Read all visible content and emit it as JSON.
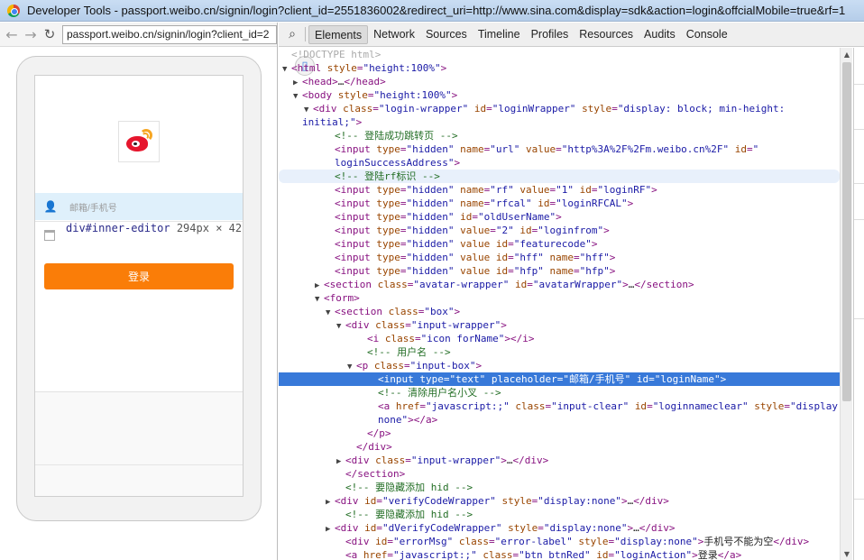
{
  "window": {
    "title": "Developer Tools - passport.weibo.cn/signin/login?client_id=2551836002&redirect_uri=http://www.sina.com&display=sdk&action=login&offcialMobile=true&rf=1"
  },
  "browser": {
    "url": "passport.weibo.cn/signin/login?client_id=2"
  },
  "page": {
    "username_placeholder": "邮箱/手机号",
    "tooltip_selector": "div#inner-editor",
    "tooltip_size_w": "294",
    "tooltip_size_h": "42",
    "tooltip_unit": "px",
    "tooltip_x": "×",
    "login_button": "登录"
  },
  "devtools": {
    "tabs": [
      "Elements",
      "Network",
      "Sources",
      "Timeline",
      "Profiles",
      "Resources",
      "Audits",
      "Console"
    ],
    "active_tab": "Elements"
  },
  "dom_lines": [
    {
      "indent": 0,
      "tri": "",
      "html": "<span class='doctype'>&lt;!DOCTYPE html&gt;</span>"
    },
    {
      "indent": 0,
      "tri": "▼",
      "html": "<span class='tag'>&lt;html</span> <span class='an'>style</span>=<span class='av'>\"height:100%\"</span><span class='tag'>&gt;</span>"
    },
    {
      "indent": 1,
      "tri": "▶",
      "html": "<span class='tag'>&lt;head&gt;</span><span class='txt'>…</span><span class='tag'>&lt;/head&gt;</span>"
    },
    {
      "indent": 1,
      "tri": "▼",
      "html": "<span class='tag'>&lt;body</span> <span class='an'>style</span>=<span class='av'>\"height:100%\"</span><span class='tag'>&gt;</span>"
    },
    {
      "indent": 2,
      "tri": "▼",
      "html": "<span class='tag'>&lt;div</span> <span class='an'>class</span>=<span class='av'>\"login-wrapper\"</span> <span class='an'>id</span>=<span class='av'>\"loginWrapper\"</span> <span class='an'>style</span>=<span class='av'>\"display: block; min-height:</span>"
    },
    {
      "indent": 1,
      "tri": "",
      "html": "<span class='av'>initial;\"</span><span class='tag'>&gt;</span>"
    },
    {
      "indent": 4,
      "tri": "",
      "html": "<span class='cm'>&lt;!-- 登陆成功跳转页 --&gt;</span>"
    },
    {
      "indent": 4,
      "tri": "",
      "html": "<span class='tag'>&lt;input</span> <span class='an'>type</span>=<span class='av'>\"hidden\"</span> <span class='an'>name</span>=<span class='av'>\"url\"</span> <span class='an'>value</span>=<span class='av'>\"http%3A%2F%2Fm.weibo.cn%2F\"</span> <span class='an'>id</span>=<span class='av'>\"</span>"
    },
    {
      "indent": 4,
      "tri": "",
      "html": "<span class='av'>loginSuccessAddress\"</span><span class='tag'>&gt;</span>"
    },
    {
      "indent": 4,
      "tri": "",
      "hover": true,
      "html": "<span class='cm'>&lt;!-- 登陆rf标识 --&gt;</span>"
    },
    {
      "indent": 4,
      "tri": "",
      "html": "<span class='tag'>&lt;input</span> <span class='an'>type</span>=<span class='av'>\"hidden\"</span> <span class='an'>name</span>=<span class='av'>\"rf\"</span> <span class='an'>value</span>=<span class='av'>\"1\"</span> <span class='an'>id</span>=<span class='av'>\"loginRF\"</span><span class='tag'>&gt;</span>"
    },
    {
      "indent": 4,
      "tri": "",
      "html": "<span class='tag'>&lt;input</span> <span class='an'>type</span>=<span class='av'>\"hidden\"</span> <span class='an'>name</span>=<span class='av'>\"rfcal\"</span> <span class='an'>id</span>=<span class='av'>\"loginRFCAL\"</span><span class='tag'>&gt;</span>"
    },
    {
      "indent": 4,
      "tri": "",
      "html": "<span class='tag'>&lt;input</span> <span class='an'>type</span>=<span class='av'>\"hidden\"</span> <span class='an'>id</span>=<span class='av'>\"oldUserName\"</span><span class='tag'>&gt;</span>"
    },
    {
      "indent": 4,
      "tri": "",
      "html": "<span class='tag'>&lt;input</span> <span class='an'>type</span>=<span class='av'>\"hidden\"</span> <span class='an'>value</span>=<span class='av'>\"2\"</span> <span class='an'>id</span>=<span class='av'>\"loginfrom\"</span><span class='tag'>&gt;</span>"
    },
    {
      "indent": 4,
      "tri": "",
      "html": "<span class='tag'>&lt;input</span> <span class='an'>type</span>=<span class='av'>\"hidden\"</span> <span class='an'>value</span> <span class='an'>id</span>=<span class='av'>\"featurecode\"</span><span class='tag'>&gt;</span>"
    },
    {
      "indent": 4,
      "tri": "",
      "html": "<span class='tag'>&lt;input</span> <span class='an'>type</span>=<span class='av'>\"hidden\"</span> <span class='an'>value</span> <span class='an'>id</span>=<span class='av'>\"hff\"</span> <span class='an'>name</span>=<span class='av'>\"hff\"</span><span class='tag'>&gt;</span>"
    },
    {
      "indent": 4,
      "tri": "",
      "html": "<span class='tag'>&lt;input</span> <span class='an'>type</span>=<span class='av'>\"hidden\"</span> <span class='an'>value</span> <span class='an'>id</span>=<span class='av'>\"hfp\"</span> <span class='an'>name</span>=<span class='av'>\"hfp\"</span><span class='tag'>&gt;</span>"
    },
    {
      "indent": 3,
      "tri": "▶",
      "html": "<span class='tag'>&lt;section</span> <span class='an'>class</span>=<span class='av'>\"avatar-wrapper\"</span> <span class='an'>id</span>=<span class='av'>\"avatarWrapper\"</span><span class='tag'>&gt;</span><span class='txt'>…</span><span class='tag'>&lt;/section&gt;</span>"
    },
    {
      "indent": 3,
      "tri": "▼",
      "html": "<span class='tag'>&lt;form&gt;</span>"
    },
    {
      "indent": 4,
      "tri": "▼",
      "html": "<span class='tag'>&lt;section</span> <span class='an'>class</span>=<span class='av'>\"box\"</span><span class='tag'>&gt;</span>"
    },
    {
      "indent": 5,
      "tri": "▼",
      "html": "<span class='tag'>&lt;div</span> <span class='an'>class</span>=<span class='av'>\"input-wrapper\"</span><span class='tag'>&gt;</span>"
    },
    {
      "indent": 7,
      "tri": "",
      "html": "<span class='tag'>&lt;i</span> <span class='an'>class</span>=<span class='av'>\"icon forName\"</span><span class='tag'>&gt;&lt;/i&gt;</span>"
    },
    {
      "indent": 7,
      "tri": "",
      "html": "<span class='cm'>&lt;!-- 用户名 --&gt;</span>"
    },
    {
      "indent": 6,
      "tri": "▼",
      "html": "<span class='tag'>&lt;p</span> <span class='an'>class</span>=<span class='av'>\"input-box\"</span><span class='tag'>&gt;</span>"
    },
    {
      "indent": 8,
      "tri": "",
      "selected": true,
      "html": "<span class='tag'>&lt;input</span> <span class='an'>type</span>=<span class='av'>\"text\"</span> <span class='an'>placeholder</span>=<span class='av'>\"邮箱/手机号\"</span> <span class='an'>id</span>=<span class='av'>\"loginName\"</span><span class='tag'>&gt;</span>"
    },
    {
      "indent": 8,
      "tri": "",
      "html": "<span class='cm'>&lt;!-- 清除用户名小叉 --&gt;</span>"
    },
    {
      "indent": 8,
      "tri": "",
      "html": "<span class='tag'>&lt;a</span> <span class='an'>href</span>=<span class='av'>\"javascript:;\"</span> <span class='an'>class</span>=<span class='av'>\"input-clear\"</span> <span class='an'>id</span>=<span class='av'>\"loginnameclear\"</span> <span class='an'>style</span>=<span class='av'>\"display:</span>"
    },
    {
      "indent": 8,
      "tri": "",
      "html": "<span class='av'>none\"</span><span class='tag'>&gt;&lt;/a&gt;</span>"
    },
    {
      "indent": 7,
      "tri": "",
      "html": "<span class='tag'>&lt;/p&gt;</span>"
    },
    {
      "indent": 6,
      "tri": "",
      "html": "<span class='tag'>&lt;/div&gt;</span>"
    },
    {
      "indent": 5,
      "tri": "▶",
      "html": "<span class='tag'>&lt;div</span> <span class='an'>class</span>=<span class='av'>\"input-wrapper\"</span><span class='tag'>&gt;</span><span class='txt'>…</span><span class='tag'>&lt;/div&gt;</span>"
    },
    {
      "indent": 5,
      "tri": "",
      "html": "<span class='tag'>&lt;/section&gt;</span>"
    },
    {
      "indent": 5,
      "tri": "",
      "html": "<span class='cm'>&lt;!-- 要隐藏添加 hid --&gt;</span>"
    },
    {
      "indent": 4,
      "tri": "▶",
      "html": "<span class='tag'>&lt;div</span> <span class='an'>id</span>=<span class='av'>\"verifyCodeWrapper\"</span> <span class='an'>style</span>=<span class='av'>\"display:none\"</span><span class='tag'>&gt;</span><span class='txt'>…</span><span class='tag'>&lt;/div&gt;</span>"
    },
    {
      "indent": 5,
      "tri": "",
      "html": "<span class='cm'>&lt;!-- 要隐藏添加 hid --&gt;</span>"
    },
    {
      "indent": 4,
      "tri": "▶",
      "html": "<span class='tag'>&lt;div</span> <span class='an'>id</span>=<span class='av'>\"dVerifyCodeWrapper\"</span> <span class='an'>style</span>=<span class='av'>\"display:none\"</span><span class='tag'>&gt;</span><span class='txt'>…</span><span class='tag'>&lt;/div&gt;</span>"
    },
    {
      "indent": 5,
      "tri": "",
      "html": "<span class='tag'>&lt;div</span> <span class='an'>id</span>=<span class='av'>\"errorMsg\"</span> <span class='an'>class</span>=<span class='av'>\"error-label\"</span> <span class='an'>style</span>=<span class='av'>\"display:none\"</span><span class='tag'>&gt;</span><span class='txt'>手机号不能为空</span><span class='tag'>&lt;/div&gt;</span>"
    },
    {
      "indent": 5,
      "tri": "",
      "html": "<span class='tag'>&lt;a</span> <span class='an'>href</span>=<span class='av'>\"javascript:;\"</span> <span class='an'>class</span>=<span class='av'>\"btn btnRed\"</span> <span class='an'>id</span>=<span class='av'>\"loginAction\"</span><span class='tag'>&gt;</span><span class='txt'>登录</span><span class='tag'>&lt;/a&gt;</span>"
    }
  ]
}
